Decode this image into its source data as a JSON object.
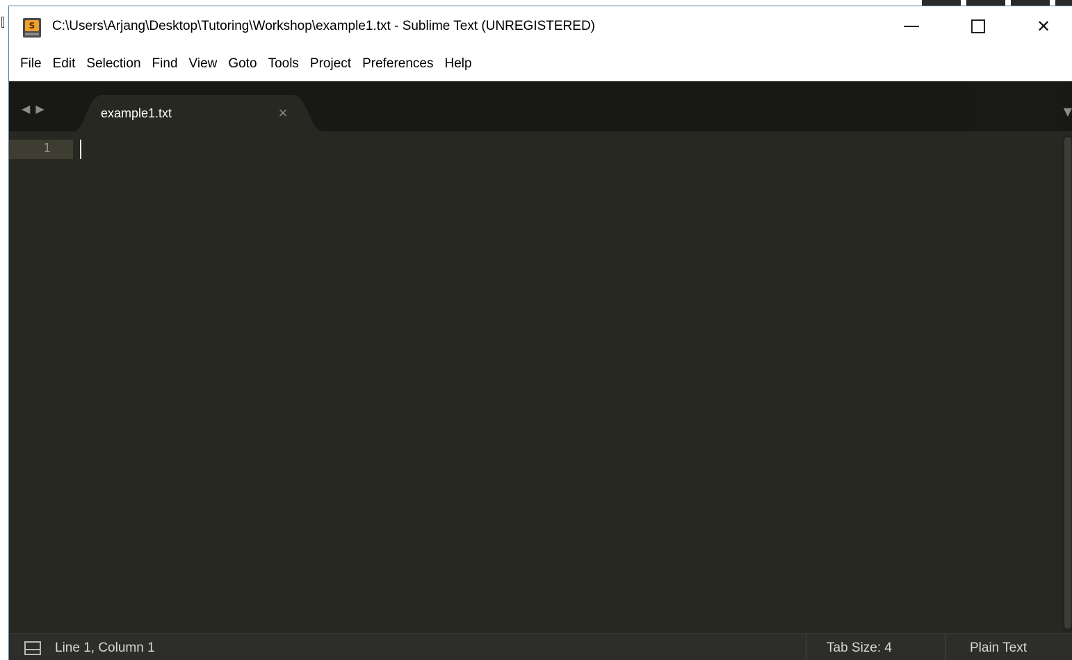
{
  "window": {
    "title": "C:\\Users\\Arjang\\Desktop\\Tutoring\\Workshop\\example1.txt - Sublime Text (UNREGISTERED)",
    "controls": {
      "minimize": "—",
      "maximize": "□",
      "close": "✕"
    }
  },
  "menu": {
    "items": [
      "File",
      "Edit",
      "Selection",
      "Find",
      "View",
      "Goto",
      "Tools",
      "Project",
      "Preferences",
      "Help"
    ]
  },
  "tabs": {
    "nav_back": "◀",
    "nav_forward": "▶",
    "active": {
      "label": "example1.txt",
      "close": "×"
    },
    "dropdown": "▼"
  },
  "editor": {
    "line_numbers": [
      "1"
    ],
    "content": ""
  },
  "status_bar": {
    "position": "Line 1, Column 1",
    "tab_size": "Tab Size: 4",
    "syntax": "Plain Text"
  },
  "colors": {
    "editor_background": "#272822",
    "tab_strip_background": "#181815",
    "status_bar_background": "#2d2d2a"
  }
}
